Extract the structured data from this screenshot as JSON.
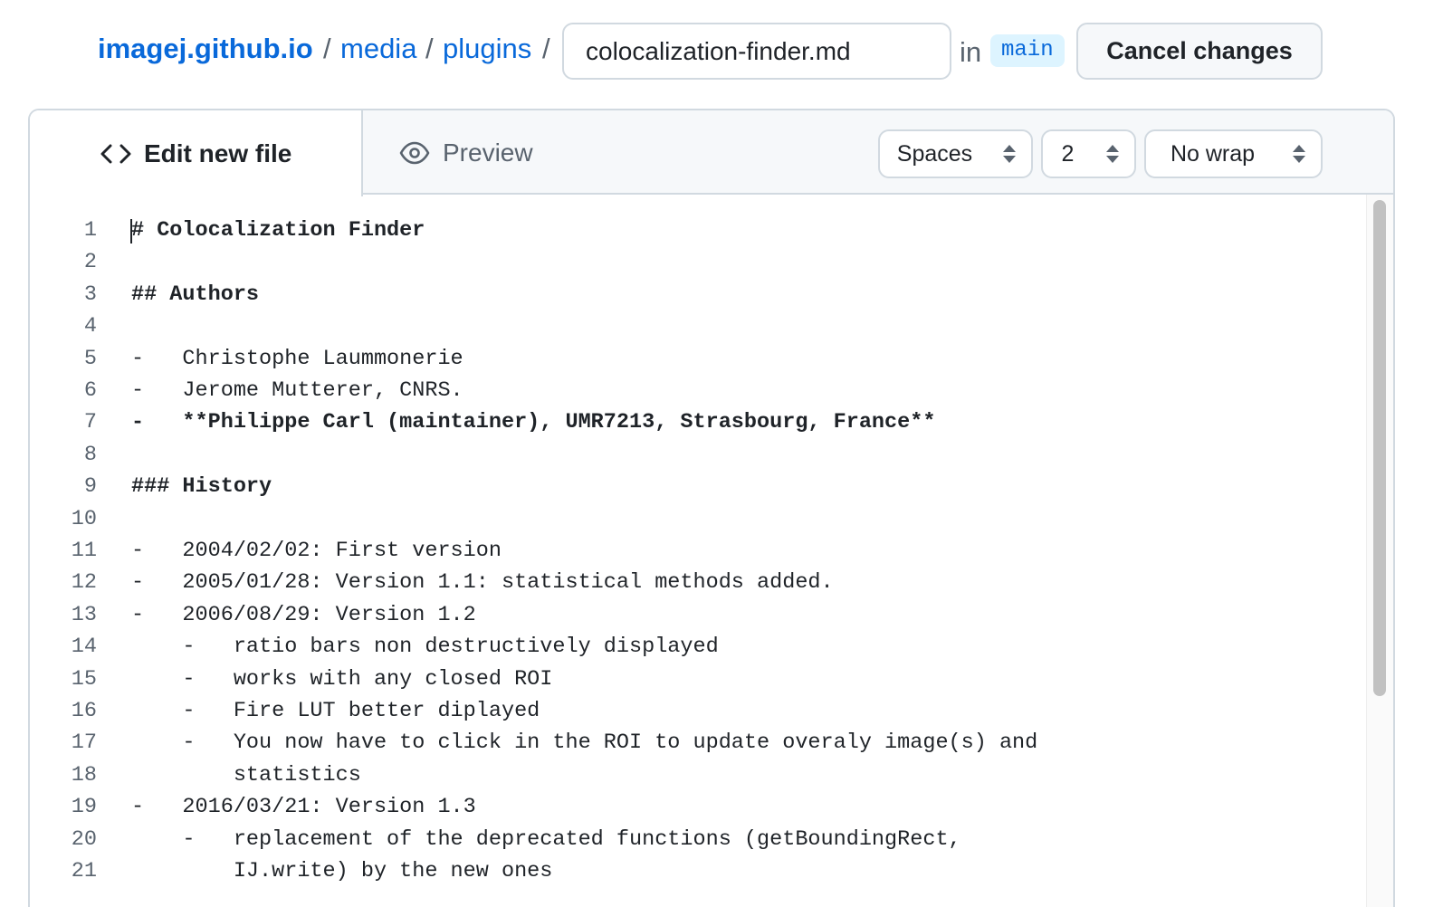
{
  "breadcrumb": {
    "repo": "imagej.github.io",
    "folders": [
      "media",
      "plugins"
    ],
    "separator": "/"
  },
  "filename": {
    "value": "colocalization-finder.md"
  },
  "branch": {
    "in_label": "in",
    "name": "main"
  },
  "actions": {
    "cancel_label": "Cancel changes"
  },
  "tabs": {
    "edit_label": "Edit new file",
    "preview_label": "Preview"
  },
  "editor_options": {
    "indent_mode": "Spaces",
    "indent_size": "2",
    "wrap_mode": "No wrap"
  },
  "code_lines": [
    {
      "n": "1",
      "text": "# Colocalization Finder",
      "bold": true
    },
    {
      "n": "2",
      "text": ""
    },
    {
      "n": "3",
      "text": "## Authors",
      "bold": true
    },
    {
      "n": "4",
      "text": ""
    },
    {
      "n": "5",
      "text": "-   Christophe Laummonerie"
    },
    {
      "n": "6",
      "text": "-   Jerome Mutterer, CNRS."
    },
    {
      "n": "7",
      "text": "-   **Philippe Carl (maintainer), UMR7213, Strasbourg, France**",
      "bold": true
    },
    {
      "n": "8",
      "text": ""
    },
    {
      "n": "9",
      "text": "### History",
      "bold": true
    },
    {
      "n": "10",
      "text": ""
    },
    {
      "n": "11",
      "text": "-   2004/02/02: First version"
    },
    {
      "n": "12",
      "text": "-   2005/01/28: Version 1.1: statistical methods added."
    },
    {
      "n": "13",
      "text": "-   2006/08/29: Version 1.2"
    },
    {
      "n": "14",
      "text": "    -   ratio bars non destructively displayed"
    },
    {
      "n": "15",
      "text": "    -   works with any closed ROI"
    },
    {
      "n": "16",
      "text": "    -   Fire LUT better diplayed"
    },
    {
      "n": "17",
      "text": "    -   You now have to click in the ROI to update overaly image(s) and"
    },
    {
      "n": "18",
      "text": "        statistics"
    },
    {
      "n": "19",
      "text": "-   2016/03/21: Version 1.3"
    },
    {
      "n": "20",
      "text": "    -   replacement of the deprecated functions (getBoundingRect,"
    },
    {
      "n": "21",
      "text": "        IJ.write) by the new ones"
    }
  ],
  "colors": {
    "link": "#0969da",
    "text": "#1f2328",
    "muted": "#59636e",
    "border": "#d1d9e0",
    "badge_bg": "#ddf4ff",
    "tabbar_bg": "#f6f8fa"
  },
  "icons": {
    "edit_tab": "code-icon",
    "preview_tab": "eye-icon",
    "select_caret": "select-caret-icon"
  }
}
